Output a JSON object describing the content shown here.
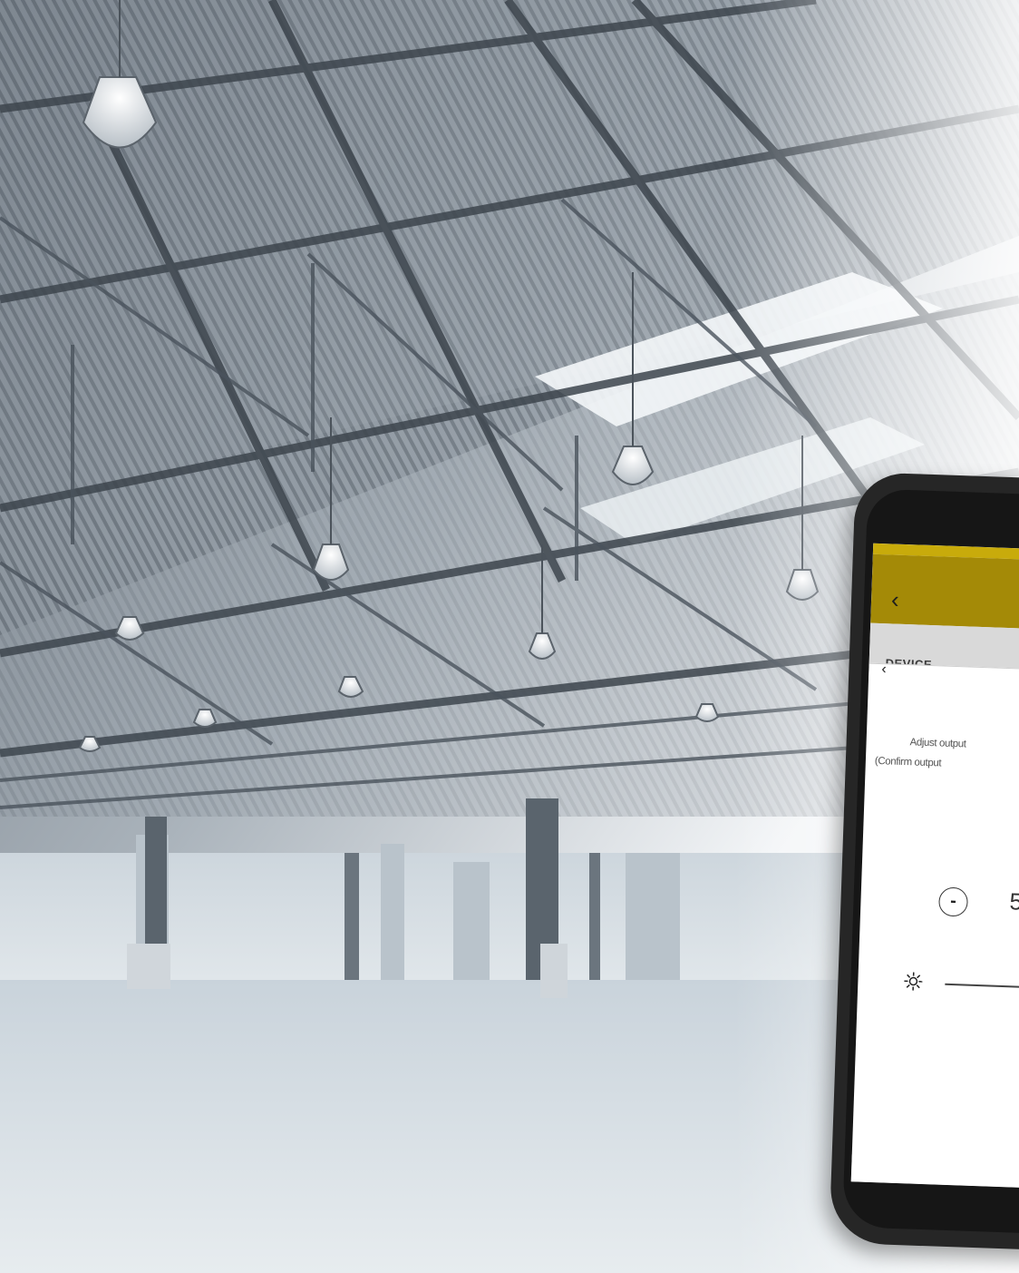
{
  "app": {
    "section_title": "DEVICE",
    "back_symbol": "‹",
    "hint_line_1": "Adjust output",
    "hint_line_2": "(Confirm output",
    "decrement_symbol": "-",
    "value": "5",
    "brightness_icon": "sun-icon",
    "back_icon": "chevron-left-icon"
  },
  "colors": {
    "app_bar": "#a48a07",
    "device_bar": "#d9d9d9",
    "phone_body": "#262626",
    "screen": "#ffffff"
  }
}
